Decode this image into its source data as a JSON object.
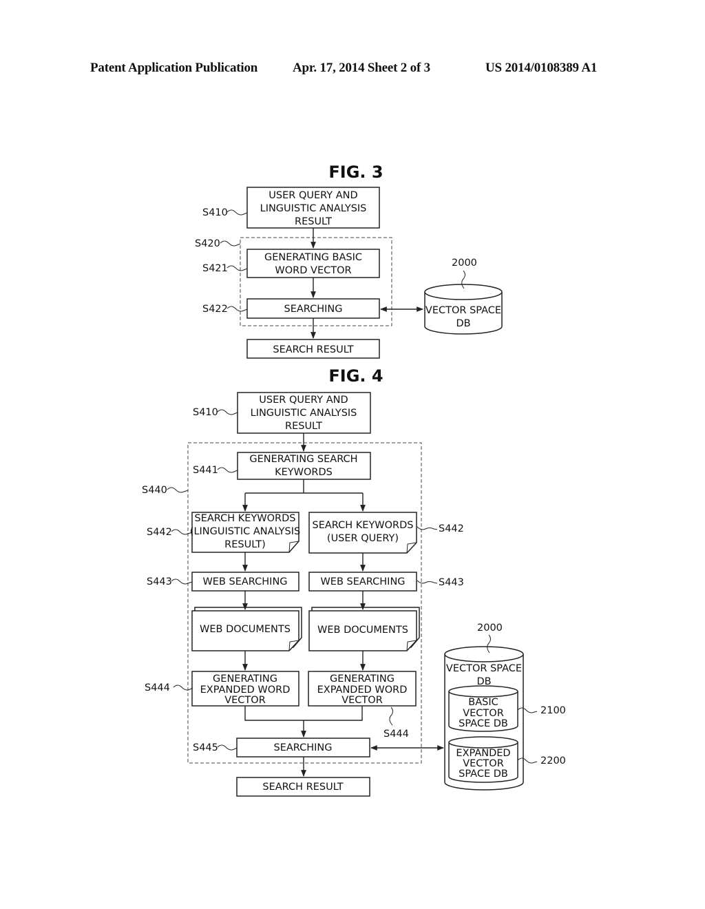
{
  "header": {
    "left": "Patent Application Publication",
    "middle": "Apr. 17, 2014  Sheet 2 of 3",
    "right": "US 2014/0108389 A1"
  },
  "fig3": {
    "title": "FIG. 3",
    "steps": {
      "s410": {
        "label": "S410",
        "lines": [
          "USER QUERY AND",
          "LINGUISTIC ANALYSIS",
          "RESULT"
        ]
      },
      "s420": {
        "label": "S420"
      },
      "s421": {
        "label": "S421",
        "lines": [
          "GENERATING BASIC",
          "WORD VECTOR"
        ]
      },
      "s422": {
        "label": "S422",
        "lines": [
          "SEARCHING"
        ]
      },
      "result": {
        "lines": [
          "SEARCH RESULT"
        ]
      }
    },
    "db": {
      "ref": "2000",
      "lines": [
        "VECTOR SPACE",
        "DB"
      ]
    }
  },
  "fig4": {
    "title": "FIG. 4",
    "steps": {
      "s410": {
        "label": "S410",
        "lines": [
          "USER QUERY AND",
          "LINGUISTIC ANALYSIS",
          "RESULT"
        ]
      },
      "s440": {
        "label": "S440"
      },
      "s441": {
        "label": "S441",
        "lines": [
          "GENERATING SEARCH",
          "KEYWORDS"
        ]
      },
      "s442_left": {
        "label": "S442",
        "lines": [
          "SEARCH KEYWORDS",
          "(LINGUISTIC ANALYSIS",
          "RESULT)"
        ]
      },
      "s442_right": {
        "label": "S442",
        "lines": [
          "SEARCH KEYWORDS",
          "(USER QUERY)"
        ]
      },
      "s443_left": {
        "label": "S443",
        "lines": [
          "WEB SEARCHING"
        ]
      },
      "s443_right": {
        "label": "S443",
        "lines": [
          "WEB SEARCHING"
        ]
      },
      "docs_left": {
        "lines": [
          "WEB DOCUMENTS"
        ]
      },
      "docs_right": {
        "lines": [
          "WEB DOCUMENTS"
        ]
      },
      "s444_left": {
        "label": "S444",
        "lines": [
          "GENERATING",
          "EXPANDED WORD",
          "VECTOR"
        ]
      },
      "s444_right": {
        "label": "S444",
        "lines": [
          "GENERATING",
          "EXPANDED WORD",
          "VECTOR"
        ]
      },
      "s445": {
        "label": "S445",
        "lines": [
          "SEARCHING"
        ]
      },
      "result": {
        "lines": [
          "SEARCH RESULT"
        ]
      }
    },
    "db": {
      "ref": "2000",
      "lines": [
        "VECTOR SPACE",
        "DB"
      ],
      "basic": {
        "ref": "2100",
        "lines": [
          "BASIC",
          "VECTOR",
          "SPACE DB"
        ]
      },
      "expanded": {
        "ref": "2200",
        "lines": [
          "EXPANDED",
          "VECTOR",
          "SPACE DB"
        ]
      }
    }
  }
}
